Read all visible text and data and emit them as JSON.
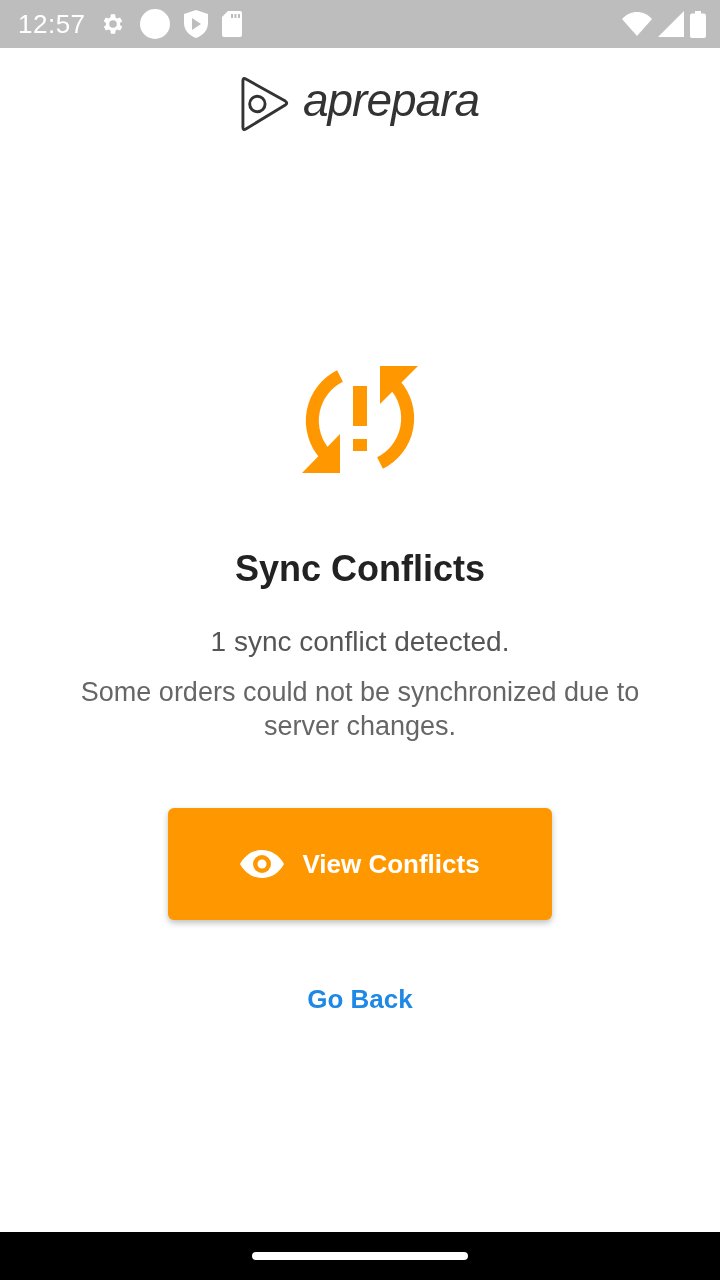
{
  "status_bar": {
    "time": "12:57"
  },
  "header": {
    "logo_text": "aprepara"
  },
  "message": {
    "title": "Sync Conflicts",
    "summary": "1 sync conflict detected.",
    "detail": "Some orders could not be synchronized due to server changes."
  },
  "actions": [
    {
      "kind": "primary",
      "label": "View Conflicts"
    },
    {
      "kind": "link",
      "label": "Go Back"
    }
  ]
}
